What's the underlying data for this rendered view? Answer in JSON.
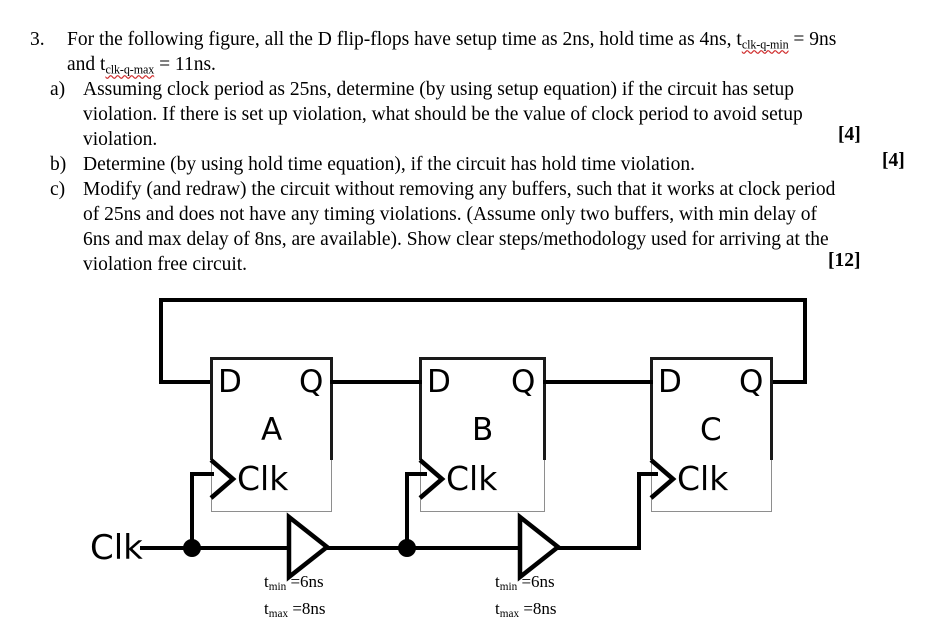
{
  "question": {
    "number": "3.",
    "stem_line1_a": "For the following figure, all the D flip-flops have setup time as 2ns, hold time as 4ns, t",
    "stem_line1_sub": "clk-q-min",
    "stem_line1_b": " = 9ns",
    "stem_line2_a": "and t",
    "stem_line2_sub": "clk-q-max",
    "stem_line2_b": " = 11ns.",
    "parts": [
      {
        "label": "a)",
        "lines": [
          "Assuming clock period as 25ns, determine (by using setup equation) if the circuit has setup",
          "violation. If there is set up violation, what should be the value of clock period to avoid setup",
          "violation."
        ],
        "marks": "[4]"
      },
      {
        "label": "b)",
        "lines": [
          "Determine (by using hold time equation), if the circuit has hold time violation."
        ],
        "marks": "[4]"
      },
      {
        "label": "c)",
        "lines": [
          "Modify (and redraw) the circuit without removing any buffers, such that it works at clock period",
          "of 25ns and does not have any timing violations. (Assume only two buffers, with min delay of",
          "6ns and max delay of 8ns, are available).  Show clear steps/methodology used for arriving at the",
          "violation free circuit."
        ],
        "marks": "[12]"
      }
    ]
  },
  "circuit": {
    "clock_input_label": "Clk",
    "flipflops": [
      {
        "name": "A",
        "d_label": "D",
        "q_label": "Q",
        "clk_label": "Clk"
      },
      {
        "name": "B",
        "d_label": "D",
        "q_label": "Q",
        "clk_label": "Clk"
      },
      {
        "name": "C",
        "d_label": "D",
        "q_label": "Q",
        "clk_label": "Clk"
      }
    ],
    "buffers": [
      {
        "tmin_t": "t",
        "tmin_sub": "min",
        "tmin_val": " =6ns",
        "tmax_t": "t",
        "tmax_sub": "max",
        "tmax_val": " =8ns"
      },
      {
        "tmin_t": "t",
        "tmin_sub": "min",
        "tmin_val": " =6ns",
        "tmax_t": "t",
        "tmax_sub": "max",
        "tmax_val": " =8ns"
      }
    ],
    "colors": {
      "wire": "#000000",
      "box_border": "#8e8e8e",
      "box_heavy": "#1a1a1a",
      "background": "#ffffff"
    }
  }
}
